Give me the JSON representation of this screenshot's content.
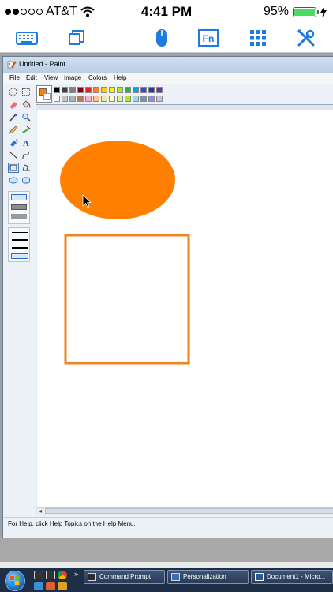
{
  "status_bar": {
    "carrier": "AT&T",
    "time": "4:41 PM",
    "battery": "95%"
  },
  "app_toolbar": {
    "icons": [
      "keyboard-icon",
      "windows-icon",
      "mouse-icon",
      "fn-icon",
      "grid-icon",
      "tools-icon"
    ],
    "fn_label": "Fn"
  },
  "paint": {
    "title": "Untitled - Paint",
    "menus": [
      "File",
      "Edit",
      "View",
      "Image",
      "Colors",
      "Help"
    ],
    "status_text": "For Help, click Help Topics on the Help Menu.",
    "foreground_color": "#ff8000",
    "palette_row1": [
      "#000000",
      "#404040",
      "#7f7f7f",
      "#880015",
      "#ed1c24",
      "#ff7f27",
      "#ffc90e",
      "#fff200",
      "#b5e61d",
      "#22b14c",
      "#00a2e8",
      "#3f48cc",
      "#2f3699",
      "#6f3198"
    ],
    "palette_row2": [
      "#ffffff",
      "#c3c3c3",
      "#b0b0b0",
      "#b97a57",
      "#ffaec9",
      "#ffc38a",
      "#efe4b0",
      "#fffcc8",
      "#d4f0a0",
      "#b5e61d",
      "#99d9ea",
      "#7092be",
      "#8a8fd6",
      "#c8bfe7"
    ],
    "shape_fill_color": "#ff8000",
    "shape_stroke_color": "#f0831e"
  },
  "taskbar": {
    "buttons": [
      {
        "label": "Command Prompt"
      },
      {
        "label": "Personalization"
      },
      {
        "label": "Document1 - Micro..."
      }
    ]
  }
}
